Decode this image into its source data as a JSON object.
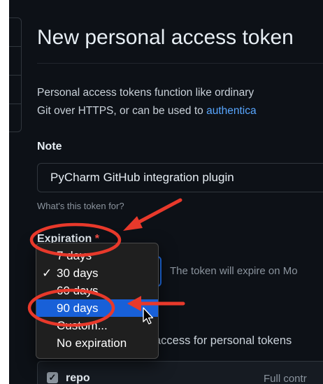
{
  "page": {
    "title": "New personal access token",
    "description_line1": "Personal access tokens function like ordinary",
    "description_line2_prefix": "Git over HTTPS, or can be used to ",
    "description_link": "authentica"
  },
  "note": {
    "label": "Note",
    "value": "PyCharm GitHub integration plugin",
    "hint": "What's this token for?"
  },
  "expiration": {
    "label": "Expiration",
    "required_mark": "*",
    "expire_text": "The token will expire on Mo",
    "checkmark": "✓",
    "options": [
      {
        "label": "7 days",
        "checked": false,
        "highlighted": false
      },
      {
        "label": "30 days",
        "checked": true,
        "highlighted": false
      },
      {
        "label": "60 days",
        "checked": false,
        "highlighted": false
      },
      {
        "label": "90 days",
        "checked": false,
        "highlighted": true
      },
      {
        "label": "Custom...",
        "checked": false,
        "highlighted": false
      },
      {
        "label": "No expiration",
        "checked": false,
        "highlighted": false
      }
    ]
  },
  "scopes": {
    "intro": "access for personal tokens",
    "items": [
      {
        "name": "repo",
        "description": "Full contr",
        "checked": true,
        "check_glyph": "✓"
      }
    ]
  },
  "colors": {
    "background": "#0d1117",
    "accent_blue": "#1f6feb",
    "highlight": "#1860d8",
    "annotation_red": "#e8392b"
  },
  "icons": [
    "checkmark-icon",
    "mouse-cursor-icon",
    "red-arrow-icon",
    "red-circle-highlight"
  ]
}
